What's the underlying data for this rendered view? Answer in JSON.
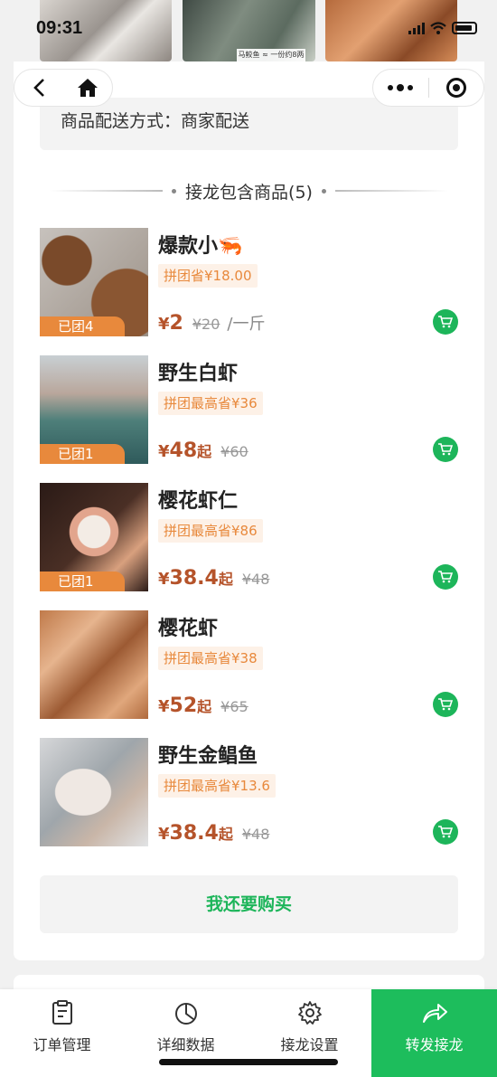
{
  "status_bar": {
    "time": "09:31"
  },
  "top_strip": {
    "caption": "马鲛鱼 ≈ 一份约8两"
  },
  "delivery": {
    "text": "商品配送方式：商家配送"
  },
  "section": {
    "title": "接龙包含商品(5)"
  },
  "products": [
    {
      "name": "爆款小🦐",
      "tag": "拼团省¥18.00",
      "badge": "已团4",
      "price_symbol": "¥",
      "price": "2",
      "qi": "",
      "original": "¥20",
      "unit": "/一斤"
    },
    {
      "name": "野生白虾",
      "tag": "拼团最高省¥36",
      "badge": "已团1",
      "price_symbol": "¥",
      "price": "48",
      "qi": "起",
      "original": "¥60",
      "unit": ""
    },
    {
      "name": "樱花虾仁",
      "tag": "拼团最高省¥86",
      "badge": "已团1",
      "price_symbol": "¥",
      "price": "38.4",
      "qi": "起",
      "original": "¥48",
      "unit": ""
    },
    {
      "name": "樱花虾",
      "tag": "拼团最高省¥38",
      "badge": "",
      "price_symbol": "¥",
      "price": "52",
      "qi": "起",
      "original": "¥65",
      "unit": ""
    },
    {
      "name": "野生金鲳鱼",
      "tag": "拼团最高省¥13.6",
      "badge": "",
      "price_symbol": "¥",
      "price": "38.4",
      "qi": "起",
      "original": "¥48",
      "unit": ""
    }
  ],
  "buy_more": {
    "label": "我还要购买"
  },
  "bottom_bar": {
    "tabs": [
      {
        "label": "订单管理",
        "icon": "clipboard-icon"
      },
      {
        "label": "详细数据",
        "icon": "pie-chart-icon"
      },
      {
        "label": "接龙设置",
        "icon": "gear-icon"
      },
      {
        "label": "转发接龙",
        "icon": "share-arrow-icon"
      }
    ]
  },
  "colors": {
    "accent_green": "#1db55a",
    "price_brown": "#b5532a",
    "tag_orange": "#e8893c"
  }
}
